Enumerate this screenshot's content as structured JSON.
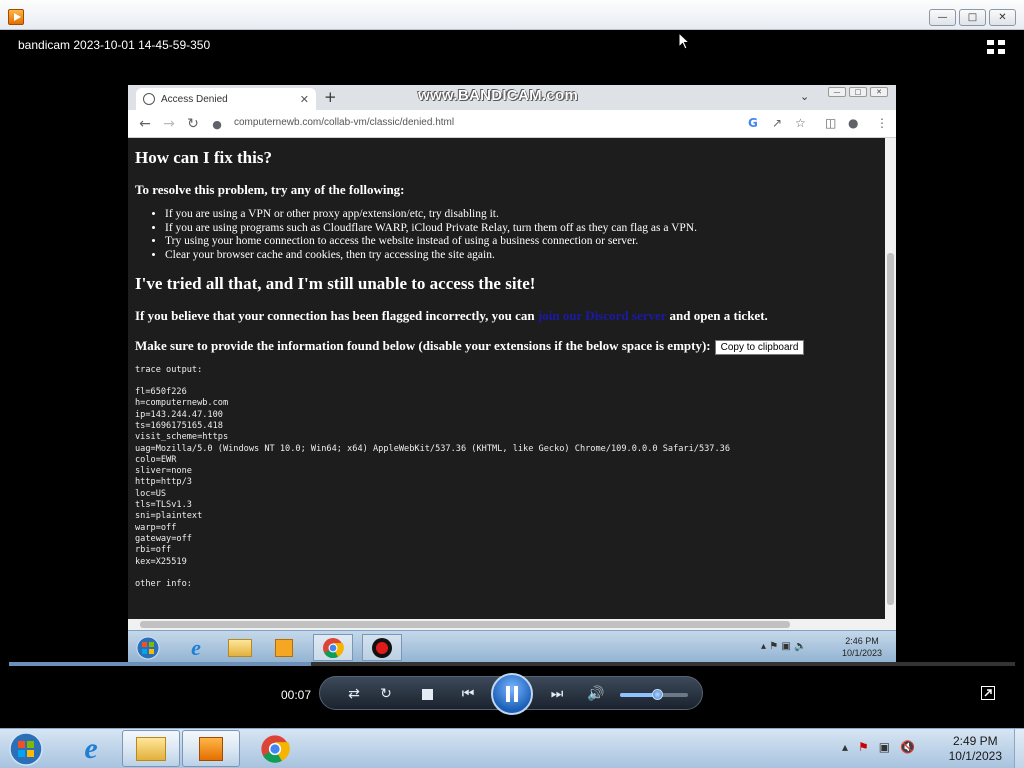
{
  "player": {
    "video_title": "bandicam 2023-10-01 14-45-59-350",
    "time": "00:07",
    "progress_fraction": 0.3,
    "volume_fraction": 0.55
  },
  "browser": {
    "tab_title": "Access Denied",
    "watermark": "www.BANDICAM.com",
    "url": "computernewb.com/collab-vm/classic/denied.html"
  },
  "page": {
    "heading1": "How can I fix this?",
    "resolve_intro": "To resolve this problem, try any of the following:",
    "bullets": [
      "If you are using a VPN or other proxy app/extension/etc, try disabling it.",
      "If you are using programs such as Cloudflare WARP, iCloud Private Relay, turn them off as they can flag as a VPN.",
      "Try using your home connection to access the website instead of using a business connection or server.",
      "Clear your browser cache and cookies, then try accessing the site again."
    ],
    "heading2": "I've tried all that, and I'm still unable to access the site!",
    "flagged_before": "If you believe that your connection has been flagged incorrectly, you can ",
    "flagged_link": "join our Discord server",
    "flagged_after": " and open a ticket.",
    "provide_info": "Make sure to provide the information found below (disable your extensions if the below space is empty):",
    "copy_button": "Copy to clipboard",
    "trace_output": "trace output:\n\nfl=650f226\nh=computernewb.com\nip=143.244.47.100\nts=1696175165.418\nvisit_scheme=https\nuag=Mozilla/5.0 (Windows NT 10.0; Win64; x64) AppleWebKit/537.36 (KHTML, like Gecko) Chrome/109.0.0.0 Safari/537.36\ncolo=EWR\nsliver=none\nhttp=http/3\nloc=US\ntls=TLSv1.3\nsni=plaintext\nwarp=off\ngateway=off\nrbi=off\nkex=X25519\n\nother info:"
  },
  "inner_taskbar": {
    "time": "2:46 PM",
    "date": "10/1/2023"
  },
  "taskbar": {
    "time": "2:49 PM",
    "date": "10/1/2023"
  }
}
